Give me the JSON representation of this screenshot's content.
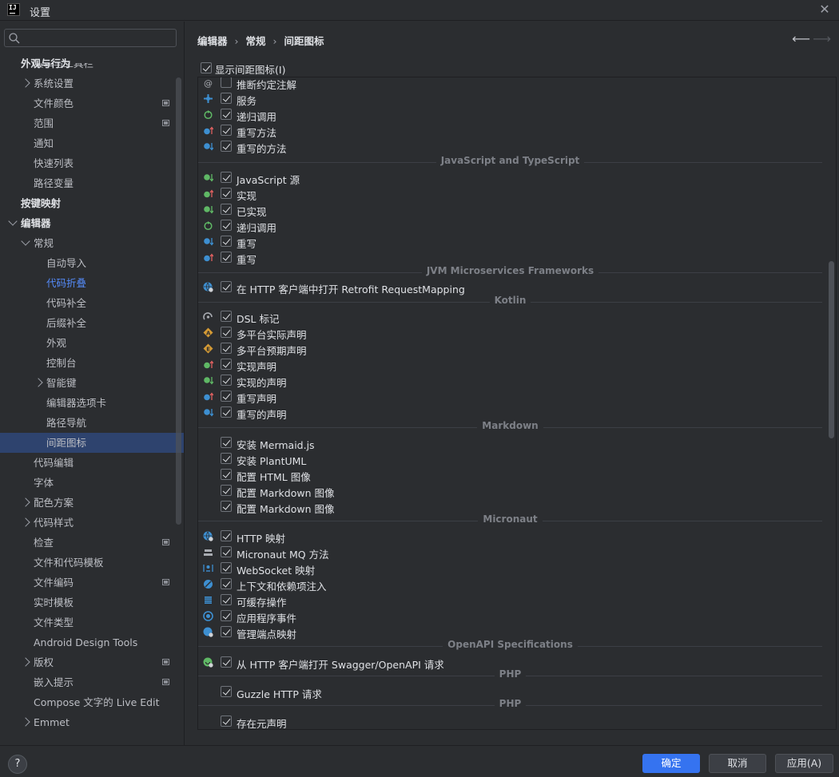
{
  "window": {
    "title": "设置",
    "logo": "IJ"
  },
  "search": {
    "placeholder": ""
  },
  "sidebar": {
    "cut_item": "菜单与工具栏",
    "items": [
      {
        "label": "外观与行为",
        "level": 0,
        "bold": true
      },
      {
        "label": "系统设置",
        "level": 1,
        "chevron": "right"
      },
      {
        "label": "文件颜色",
        "level": 1,
        "project": true
      },
      {
        "label": "范围",
        "level": 1,
        "project": true
      },
      {
        "label": "通知",
        "level": 1
      },
      {
        "label": "快速列表",
        "level": 1
      },
      {
        "label": "路径变量",
        "level": 1
      },
      {
        "label": "按键映射",
        "level": 0,
        "bold": true
      },
      {
        "label": "编辑器",
        "level": 0,
        "bold": true,
        "chevron": "down"
      },
      {
        "label": "常规",
        "level": 1,
        "chevron": "down"
      },
      {
        "label": "自动导入",
        "level": 2
      },
      {
        "label": "代码折叠",
        "level": 2,
        "link": true
      },
      {
        "label": "代码补全",
        "level": 2
      },
      {
        "label": "后缀补全",
        "level": 2
      },
      {
        "label": "外观",
        "level": 2
      },
      {
        "label": "控制台",
        "level": 2
      },
      {
        "label": "智能键",
        "level": 2,
        "chevron": "right"
      },
      {
        "label": "编辑器选项卡",
        "level": 2
      },
      {
        "label": "路径导航",
        "level": 2
      },
      {
        "label": "间距图标",
        "level": 2,
        "selected": true
      },
      {
        "label": "代码编辑",
        "level": 1
      },
      {
        "label": "字体",
        "level": 1
      },
      {
        "label": "配色方案",
        "level": 1,
        "chevron": "right"
      },
      {
        "label": "代码样式",
        "level": 1,
        "chevron": "right"
      },
      {
        "label": "检查",
        "level": 1,
        "project": true
      },
      {
        "label": "文件和代码模板",
        "level": 1
      },
      {
        "label": "文件编码",
        "level": 1,
        "project": true
      },
      {
        "label": "实时模板",
        "level": 1
      },
      {
        "label": "文件类型",
        "level": 1
      },
      {
        "label": "Android Design Tools",
        "level": 1
      },
      {
        "label": "版权",
        "level": 1,
        "chevron": "right",
        "project": true
      },
      {
        "label": "嵌入提示",
        "level": 1,
        "project": true
      },
      {
        "label": "Compose 文字的 Live Edit",
        "level": 1
      },
      {
        "label": "Emmet",
        "level": 1,
        "chevron": "right"
      }
    ]
  },
  "breadcrumb": [
    "编辑器",
    "常规",
    "间距图标"
  ],
  "show_gutter": {
    "label": "显示间距图标(I)",
    "checked": true
  },
  "entries": [
    {
      "kind": "row",
      "icon": "at-icon",
      "color": "#a8abb1",
      "label": "推断约定注解",
      "checked": false
    },
    {
      "kind": "row",
      "icon": "service-icon",
      "color": "#3d8fd1",
      "label": "服务",
      "checked": true
    },
    {
      "kind": "row",
      "icon": "recursion-icon",
      "color": "#5fb865",
      "label": "递归调用",
      "checked": true
    },
    {
      "kind": "row",
      "icon": "override-up-icon",
      "color": "#3d8fd1",
      "label": "重写方法",
      "checked": true
    },
    {
      "kind": "row",
      "icon": "overridden-down-icon",
      "color": "#3d8fd1",
      "label": "重写的方法",
      "checked": true
    },
    {
      "kind": "section",
      "label": "JavaScript and TypeScript"
    },
    {
      "kind": "row",
      "icon": "implemented-down-icon",
      "color": "#5fb865",
      "label": "JavaScript 源",
      "checked": true
    },
    {
      "kind": "row",
      "icon": "implementing-up-icon",
      "color": "#5fb865",
      "label": "实现",
      "checked": true
    },
    {
      "kind": "row",
      "icon": "implemented-down-icon",
      "color": "#5fb865",
      "label": "已实现",
      "checked": true
    },
    {
      "kind": "row",
      "icon": "recursion-icon",
      "color": "#5fb865",
      "label": "递归调用",
      "checked": true
    },
    {
      "kind": "row",
      "icon": "overridden-down-icon",
      "color": "#3d8fd1",
      "label": "重写",
      "checked": true
    },
    {
      "kind": "row",
      "icon": "override-up-icon",
      "color": "#3d8fd1",
      "label": "重写",
      "checked": true
    },
    {
      "kind": "section",
      "label": "JVM Microservices Frameworks"
    },
    {
      "kind": "row",
      "icon": "http-globe-icon",
      "color": "#3d8fd1",
      "label": "在 HTTP 客户端中打开 Retrofit RequestMapping",
      "checked": true
    },
    {
      "kind": "section",
      "label": "Kotlin"
    },
    {
      "kind": "row",
      "icon": "dsl-marker-icon",
      "color": "#a8abb1",
      "label": "DSL 标记",
      "checked": true
    },
    {
      "kind": "row",
      "icon": "actual-icon",
      "color": "#d49a35",
      "label": "多平台实际声明",
      "checked": true
    },
    {
      "kind": "row",
      "icon": "expect-icon",
      "color": "#d49a35",
      "label": "多平台预期声明",
      "checked": true
    },
    {
      "kind": "row",
      "icon": "implementing-up-icon",
      "color": "#5fb865",
      "label": "实现声明",
      "checked": true
    },
    {
      "kind": "row",
      "icon": "implemented-down-icon",
      "color": "#5fb865",
      "label": "实现的声明",
      "checked": true
    },
    {
      "kind": "row",
      "icon": "override-up-icon",
      "color": "#3d8fd1",
      "label": "重写声明",
      "checked": true
    },
    {
      "kind": "row",
      "icon": "overridden-down-icon",
      "color": "#3d8fd1",
      "label": "重写的声明",
      "checked": true
    },
    {
      "kind": "section",
      "label": "Markdown"
    },
    {
      "kind": "row",
      "icon": "",
      "color": "",
      "label": "安装 Mermaid.js",
      "checked": true
    },
    {
      "kind": "row",
      "icon": "",
      "color": "",
      "label": "安装 PlantUML",
      "checked": true
    },
    {
      "kind": "row",
      "icon": "",
      "color": "",
      "label": "配置 HTML 图像",
      "checked": true
    },
    {
      "kind": "row",
      "icon": "",
      "color": "",
      "label": "配置 Markdown 图像",
      "checked": true
    },
    {
      "kind": "row",
      "icon": "",
      "color": "",
      "label": "配置 Markdown 图像",
      "checked": true
    },
    {
      "kind": "section",
      "label": "Micronaut"
    },
    {
      "kind": "row",
      "icon": "http-globe-icon",
      "color": "#3d8fd1",
      "label": "HTTP 映射",
      "checked": true
    },
    {
      "kind": "row",
      "icon": "mq-icon",
      "color": "#a8abb1",
      "label": "Micronaut MQ 方法",
      "checked": true
    },
    {
      "kind": "row",
      "icon": "websocket-icon",
      "color": "#3d8fd1",
      "label": "WebSocket 映射",
      "checked": true
    },
    {
      "kind": "row",
      "icon": "injection-icon",
      "color": "#3d8fd1",
      "label": "上下文和依赖项注入",
      "checked": true
    },
    {
      "kind": "row",
      "icon": "cache-icon",
      "color": "#3d8fd1",
      "label": "可缓存操作",
      "checked": true
    },
    {
      "kind": "row",
      "icon": "event-icon",
      "color": "#3d8fd1",
      "label": "应用程序事件",
      "checked": true
    },
    {
      "kind": "row",
      "icon": "management-icon",
      "color": "#3d8fd1",
      "label": "管理端点映射",
      "checked": true
    },
    {
      "kind": "section",
      "label": "OpenAPI Specifications"
    },
    {
      "kind": "row",
      "icon": "swagger-icon",
      "color": "#5fb865",
      "label": "从 HTTP 客户端打开 Swagger/OpenAPI 请求",
      "checked": true
    },
    {
      "kind": "section",
      "label": "PHP"
    },
    {
      "kind": "row",
      "icon": "",
      "color": "",
      "label": "Guzzle HTTP 请求",
      "checked": true
    },
    {
      "kind": "section",
      "label": "PHP"
    },
    {
      "kind": "row",
      "icon": "",
      "color": "",
      "label": "存在元声明",
      "checked": true
    }
  ],
  "footer": {
    "help": "?",
    "ok": "确定",
    "cancel": "取消",
    "apply": "应用(A)"
  },
  "colors": {
    "accent": "#3573f0",
    "selection": "#2e436e",
    "link": "#548af7"
  }
}
